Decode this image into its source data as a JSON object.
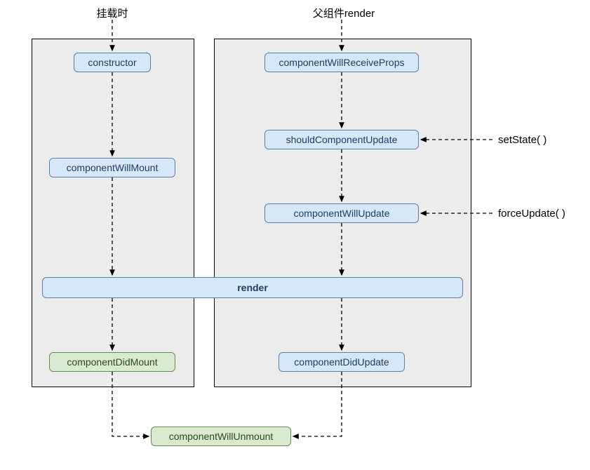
{
  "headers": {
    "mount": "挂载时",
    "parent_render": "父组件render"
  },
  "mount_flow": {
    "constructor": "constructor",
    "willMount": "componentWillMount",
    "didMount": "componentDidMount"
  },
  "update_flow": {
    "receiveProps": "componentWillReceiveProps",
    "shouldUpdate": "shouldComponentUpdate",
    "willUpdate": "componentWillUpdate",
    "didUpdate": "componentDidUpdate"
  },
  "shared": {
    "render": "render"
  },
  "unmount": {
    "willUnmount": "componentWillUnmount"
  },
  "external": {
    "setState": "setState( )",
    "forceUpdate": "forceUpdate( )"
  }
}
